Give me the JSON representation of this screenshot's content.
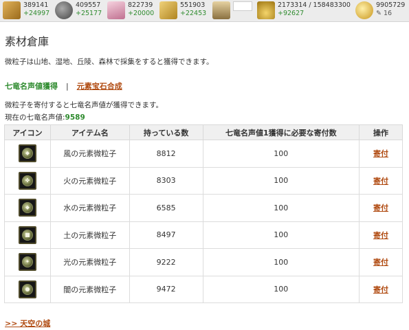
{
  "resources": [
    {
      "icon": "wood-icon",
      "amount": "389141",
      "gain": "+24997",
      "color": "#c8932f"
    },
    {
      "icon": "stone-icon",
      "amount": "409557",
      "gain": "+25177",
      "color": "#6e6e6e"
    },
    {
      "icon": "crystal-icon",
      "amount": "822739",
      "gain": "+20000",
      "color": "#e0a0b8"
    },
    {
      "icon": "grain-icon",
      "amount": "551903",
      "gain": "+22453",
      "color": "#d8b44a"
    },
    {
      "icon": "castle-icon",
      "amount": "",
      "gain": "",
      "color": "#b9a070"
    },
    {
      "icon": "gold-pile-icon",
      "amount": "2173314 / 158483300",
      "gain": "+92627",
      "color": "#caa12b"
    },
    {
      "icon": "gold-coin-icon",
      "amount": "9905729",
      "gain": "16",
      "color": "#e1b43a"
    }
  ],
  "page": {
    "title": "素材倉庫",
    "description": "微粒子は山地、湿地、丘陵、森林で採集をすると獲得できます。"
  },
  "subnav": {
    "active": "七竜名声値獲得",
    "separator": "|",
    "link": "元素宝石合成"
  },
  "notes": {
    "line1": "微粒子を寄付すると七竜名声値が獲得できます。",
    "current_label": "現在の七竜名声値:",
    "current_value": "9589"
  },
  "table": {
    "headers": [
      "アイコン",
      "アイテム名",
      "持っている数",
      "七竜名声値1獲得に必要な寄付数",
      "操作"
    ],
    "rows": [
      {
        "glyph": "◆",
        "name": "風の元素微粒子",
        "have": "8812",
        "required": "100",
        "action": "寄付"
      },
      {
        "glyph": "✤",
        "name": "火の元素微粒子",
        "have": "8303",
        "required": "100",
        "action": "寄付"
      },
      {
        "glyph": "◆",
        "name": "水の元素微粒子",
        "have": "6585",
        "required": "100",
        "action": "寄付"
      },
      {
        "glyph": "■",
        "name": "土の元素微粒子",
        "have": "8497",
        "required": "100",
        "action": "寄付"
      },
      {
        "glyph": "✦",
        "name": "光の元素微粒子",
        "have": "9222",
        "required": "100",
        "action": "寄付"
      },
      {
        "glyph": "●",
        "name": "闇の元素微粒子",
        "have": "9472",
        "required": "100",
        "action": "寄付"
      }
    ]
  },
  "footer": {
    "link": ">> 天空の城"
  }
}
